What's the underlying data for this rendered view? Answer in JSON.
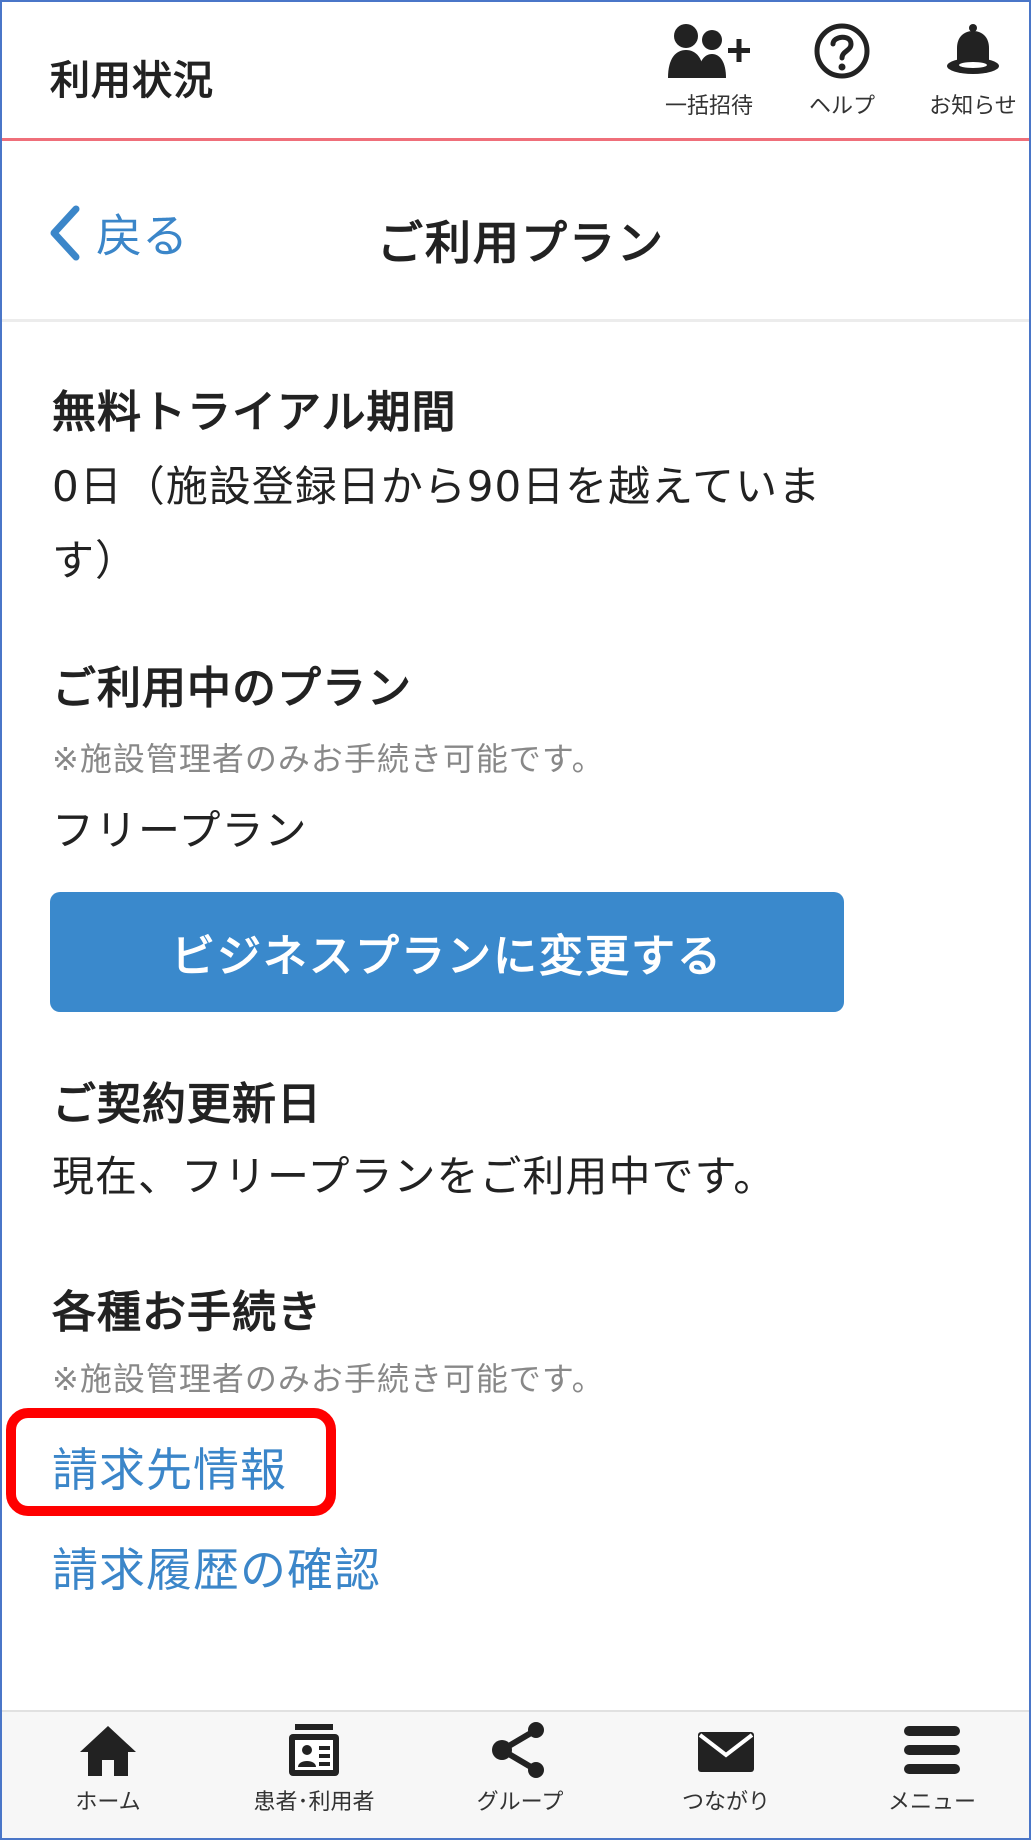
{
  "header": {
    "title": "利用状況",
    "tools": [
      {
        "label": "一括招待",
        "icon": "add-users-icon"
      },
      {
        "label": "ヘルプ",
        "icon": "help-circle-icon"
      },
      {
        "label": "お知らせ",
        "icon": "bell-icon"
      }
    ],
    "accent_line_color": "#ef6f7a"
  },
  "subheader": {
    "back_label": "戻る",
    "page_title": "ご利用プラン"
  },
  "trial": {
    "heading": "無料トライアル期間",
    "value_line1": "0日（施設登録日から90日を越えていま",
    "value_line2": "す）"
  },
  "plan": {
    "heading": "ご利用中のプラン",
    "note": "※施設管理者のみお手続き可能です。",
    "current": "フリープラン",
    "change_button": "ビジネスプランに変更する",
    "button_color": "#3a89cc"
  },
  "renewal": {
    "heading": "ご契約更新日",
    "text": "現在、フリープランをご利用中です。"
  },
  "procedures": {
    "heading": "各種お手続き",
    "note": "※施設管理者のみお手続き可能です。",
    "links": [
      "請求先情報",
      "請求履歴の確認"
    ],
    "link_color": "#3b86c9",
    "highlight_color": "#ff0000"
  },
  "bottom_nav": [
    {
      "label": "ホーム",
      "icon": "home-icon"
    },
    {
      "label": "患者･利用者",
      "icon": "contact-card-icon"
    },
    {
      "label": "グループ",
      "icon": "share-nodes-icon"
    },
    {
      "label": "つながり",
      "icon": "envelope-icon"
    },
    {
      "label": "メニュー",
      "icon": "hamburger-menu-icon"
    }
  ]
}
